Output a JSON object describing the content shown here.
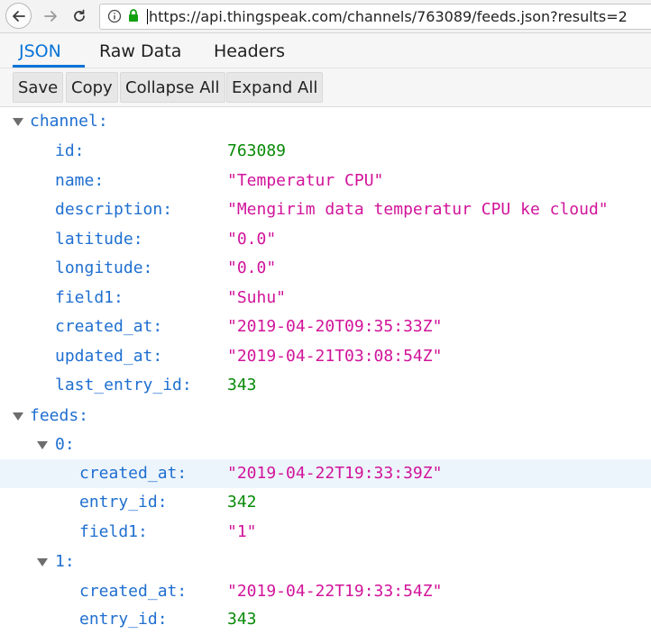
{
  "browser": {
    "url": "https://api.thingspeak.com/channels/763089/feeds.json?results=2"
  },
  "viewer": {
    "tabs": [
      {
        "label": "JSON"
      },
      {
        "label": "Raw Data"
      },
      {
        "label": "Headers"
      }
    ],
    "toolbar": {
      "save": "Save",
      "copy": "Copy",
      "collapse_all": "Collapse All",
      "expand_all": "Expand All"
    }
  },
  "json_tree": {
    "channel_key": "channel:",
    "channel": [
      {
        "key": "id:",
        "value": "763089"
      },
      {
        "key": "name:",
        "value": "\"Temperatur CPU\""
      },
      {
        "key": "description:",
        "value": "\"Mengirim data temperatur CPU ke cloud\""
      },
      {
        "key": "latitude:",
        "value": "\"0.0\""
      },
      {
        "key": "longitude:",
        "value": "\"0.0\""
      },
      {
        "key": "field1:",
        "value": "\"Suhu\""
      },
      {
        "key": "created_at:",
        "value": "\"2019-04-20T09:35:33Z\""
      },
      {
        "key": "updated_at:",
        "value": "\"2019-04-21T03:08:54Z\""
      },
      {
        "key": "last_entry_id:",
        "value": "343"
      }
    ],
    "feeds_key": "feeds:",
    "feeds": [
      {
        "index_key": "0:",
        "fields": [
          {
            "key": "created_at:",
            "value": "\"2019-04-22T19:33:39Z\""
          },
          {
            "key": "entry_id:",
            "value": "342"
          },
          {
            "key": "field1:",
            "value": "\"1\""
          }
        ]
      },
      {
        "index_key": "1:",
        "fields": [
          {
            "key": "created_at:",
            "value": "\"2019-04-22T19:33:54Z\""
          },
          {
            "key": "entry_id:",
            "value": "343"
          }
        ]
      }
    ]
  }
}
